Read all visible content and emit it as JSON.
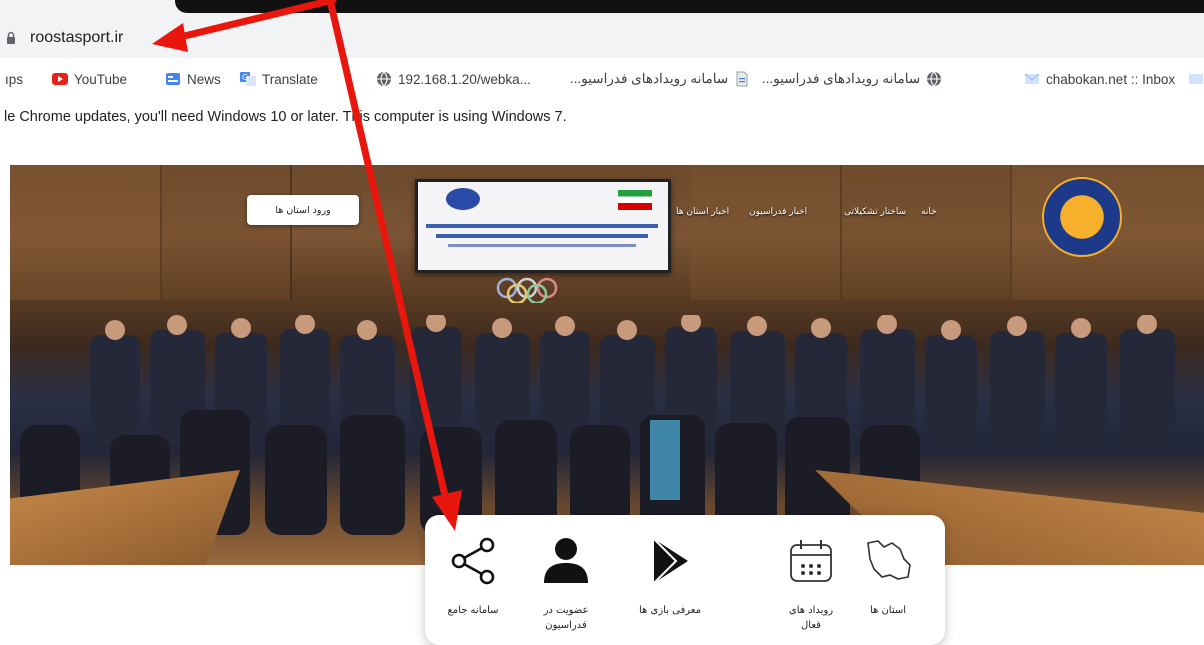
{
  "browser": {
    "url": "roostasport.ir",
    "bookmarks": [
      {
        "label": "ıps",
        "icon": "apps-icon"
      },
      {
        "label": "YouTube",
        "icon": "youtube-icon"
      },
      {
        "label": "News",
        "icon": "news-icon"
      },
      {
        "label": "Translate",
        "icon": "translate-icon"
      },
      {
        "label": "192.168.1.20/webka...",
        "icon": "globe-icon"
      },
      {
        "label": "سامانه رویدادهای فدراسیو...",
        "icon": "file-icon"
      },
      {
        "label": "سامانه رویدادهای فدراسیو...",
        "icon": "globe-icon"
      },
      {
        "label": "chabokan.net :: Inbox",
        "icon": "mail-icon"
      }
    ],
    "infobar_text": "le Chrome updates, you'll need Windows 10 or later. This computer is using Windows 7."
  },
  "site": {
    "nav": [
      "خانه",
      "ساختار تشکیلاتی",
      "اخبار فدراسیون",
      "اخبار استان ها"
    ],
    "login_button": "ورود استان ها",
    "quick_links": [
      {
        "label": "استان ها",
        "icon": "iran-map-icon"
      },
      {
        "label": "رویداد های فعال",
        "icon": "calendar-icon"
      },
      {
        "label": "معرفی بازی ها",
        "icon": "play-store-icon"
      },
      {
        "label": "عضویت در فدراسیون",
        "icon": "user-icon"
      },
      {
        "label": "سامانه جامع",
        "icon": "share-icon"
      }
    ]
  },
  "colors": {
    "annotation_arrow": "#e8160c",
    "chrome_bar": "#f1f3f4"
  }
}
